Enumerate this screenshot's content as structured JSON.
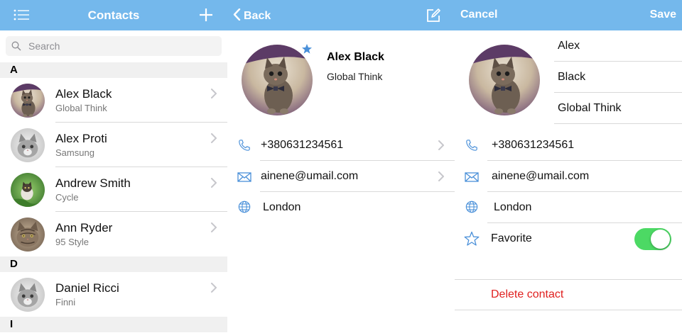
{
  "colors": {
    "nav": "#74b8ec",
    "accent": "#4a90d9",
    "toggle_on": "#4cd964",
    "delete": "#e0201f"
  },
  "list_screen": {
    "title": "Contacts",
    "menu_icon": "menu-icon",
    "add_icon": "plus-icon",
    "search": {
      "placeholder": "Search",
      "value": ""
    },
    "sections": [
      {
        "letter": "A",
        "contacts": [
          {
            "name": "Alex Black",
            "company": "Global Think",
            "avatar": "kitten-bowtie"
          },
          {
            "name": "Alex Proti",
            "company": "Samsung",
            "avatar": "kitten-grey"
          },
          {
            "name": "Andrew Smith",
            "company": "Cycle",
            "avatar": "kitten-grass"
          },
          {
            "name": "Ann Ryder",
            "company": "95 Style",
            "avatar": "kitten-tabby"
          }
        ]
      },
      {
        "letter": "D",
        "contacts": [
          {
            "name": "Daniel Ricci",
            "company": "Finni",
            "avatar": "kitten-grey"
          }
        ]
      },
      {
        "letter": "I",
        "contacts": []
      }
    ]
  },
  "detail_screen": {
    "back_label": "Back",
    "edit_icon": "edit-icon",
    "name": "Alex Black",
    "company": "Global Think",
    "favorite": true,
    "phone": "+380631234561",
    "email": "ainene@umail.com",
    "city": "London"
  },
  "edit_screen": {
    "cancel_label": "Cancel",
    "save_label": "Save",
    "first_name": "Alex",
    "last_name": "Black",
    "company": "Global Think",
    "phone": "+380631234561",
    "email": "ainene@umail.com",
    "city": "London",
    "favorite_label": "Favorite",
    "favorite_on": true,
    "delete_label": "Delete contact"
  }
}
